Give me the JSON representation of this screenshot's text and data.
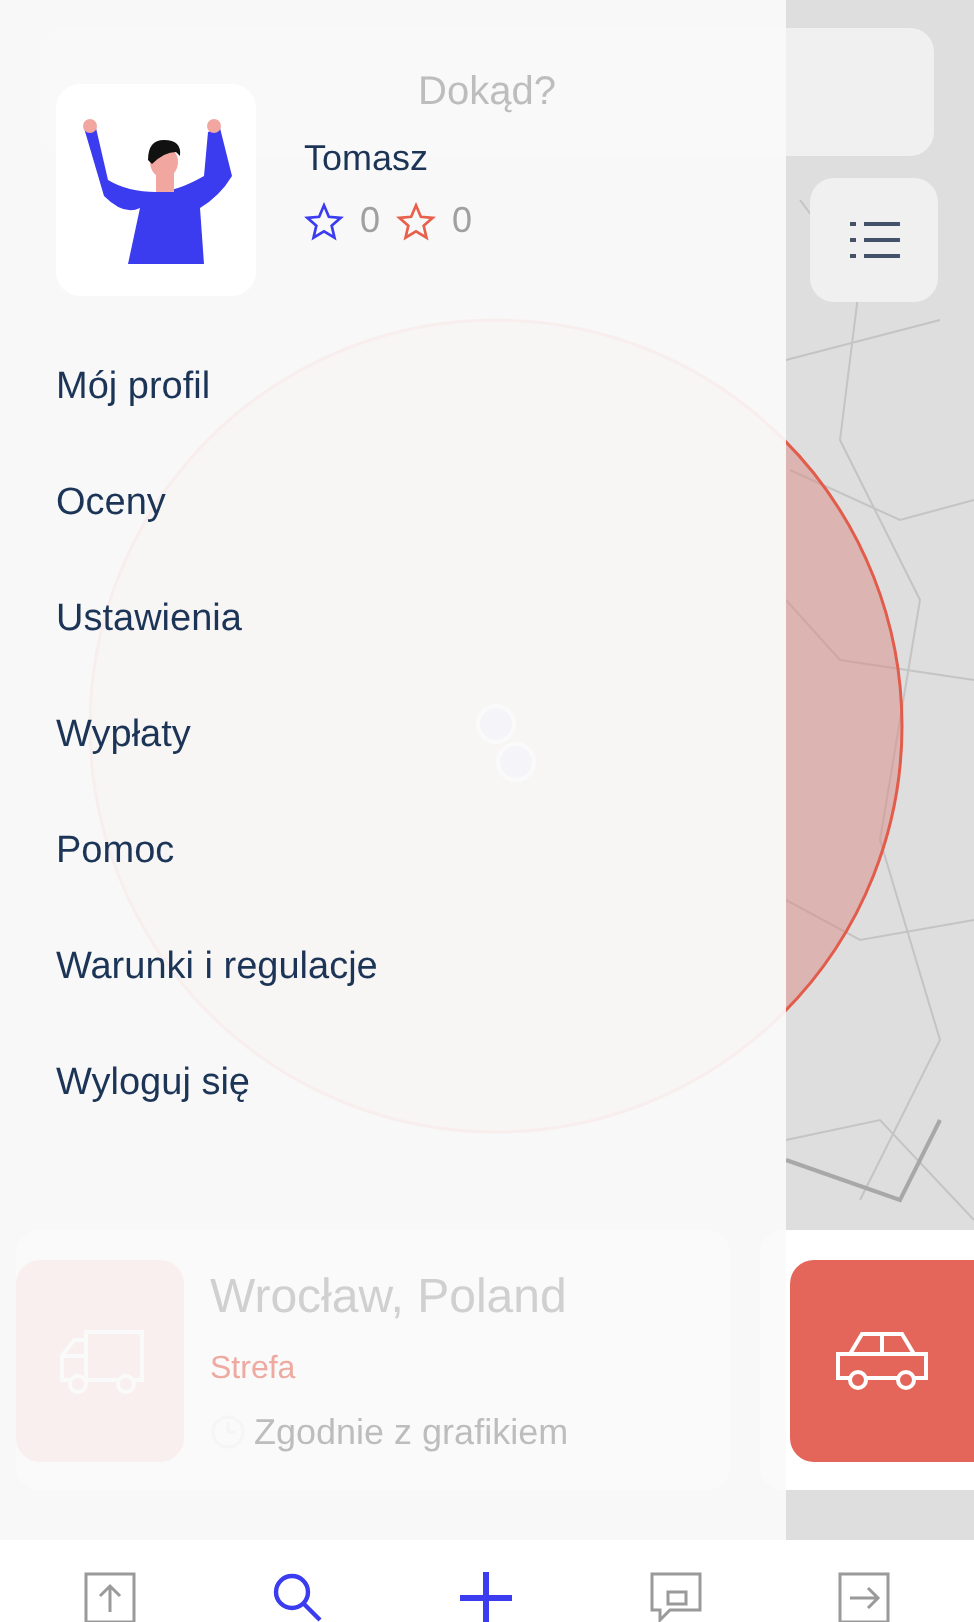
{
  "search": {
    "placeholder": "Dokąd?"
  },
  "profile": {
    "name": "Tomasz",
    "ratings": [
      {
        "color": "#3b3bf0",
        "count": "0"
      },
      {
        "color": "#e8604c",
        "count": "0"
      }
    ]
  },
  "menu": [
    {
      "label": "Mój profil"
    },
    {
      "label": "Oceny"
    },
    {
      "label": "Ustawienia"
    },
    {
      "label": "Wypłaty"
    },
    {
      "label": "Pomoc"
    },
    {
      "label": "Warunki i regulacje"
    },
    {
      "label": "Wyloguj się"
    }
  ],
  "cards": [
    {
      "kind": "truck",
      "title": "Wrocław, Poland",
      "zone": "Strefa",
      "schedule": "Zgodnie z grafikiem"
    },
    {
      "kind": "car"
    }
  ],
  "nav": [
    {
      "kind": "upload",
      "selected": false
    },
    {
      "kind": "search",
      "selected": true
    },
    {
      "kind": "add"
    },
    {
      "kind": "chat",
      "selected": false
    },
    {
      "kind": "exit",
      "selected": false
    }
  ]
}
